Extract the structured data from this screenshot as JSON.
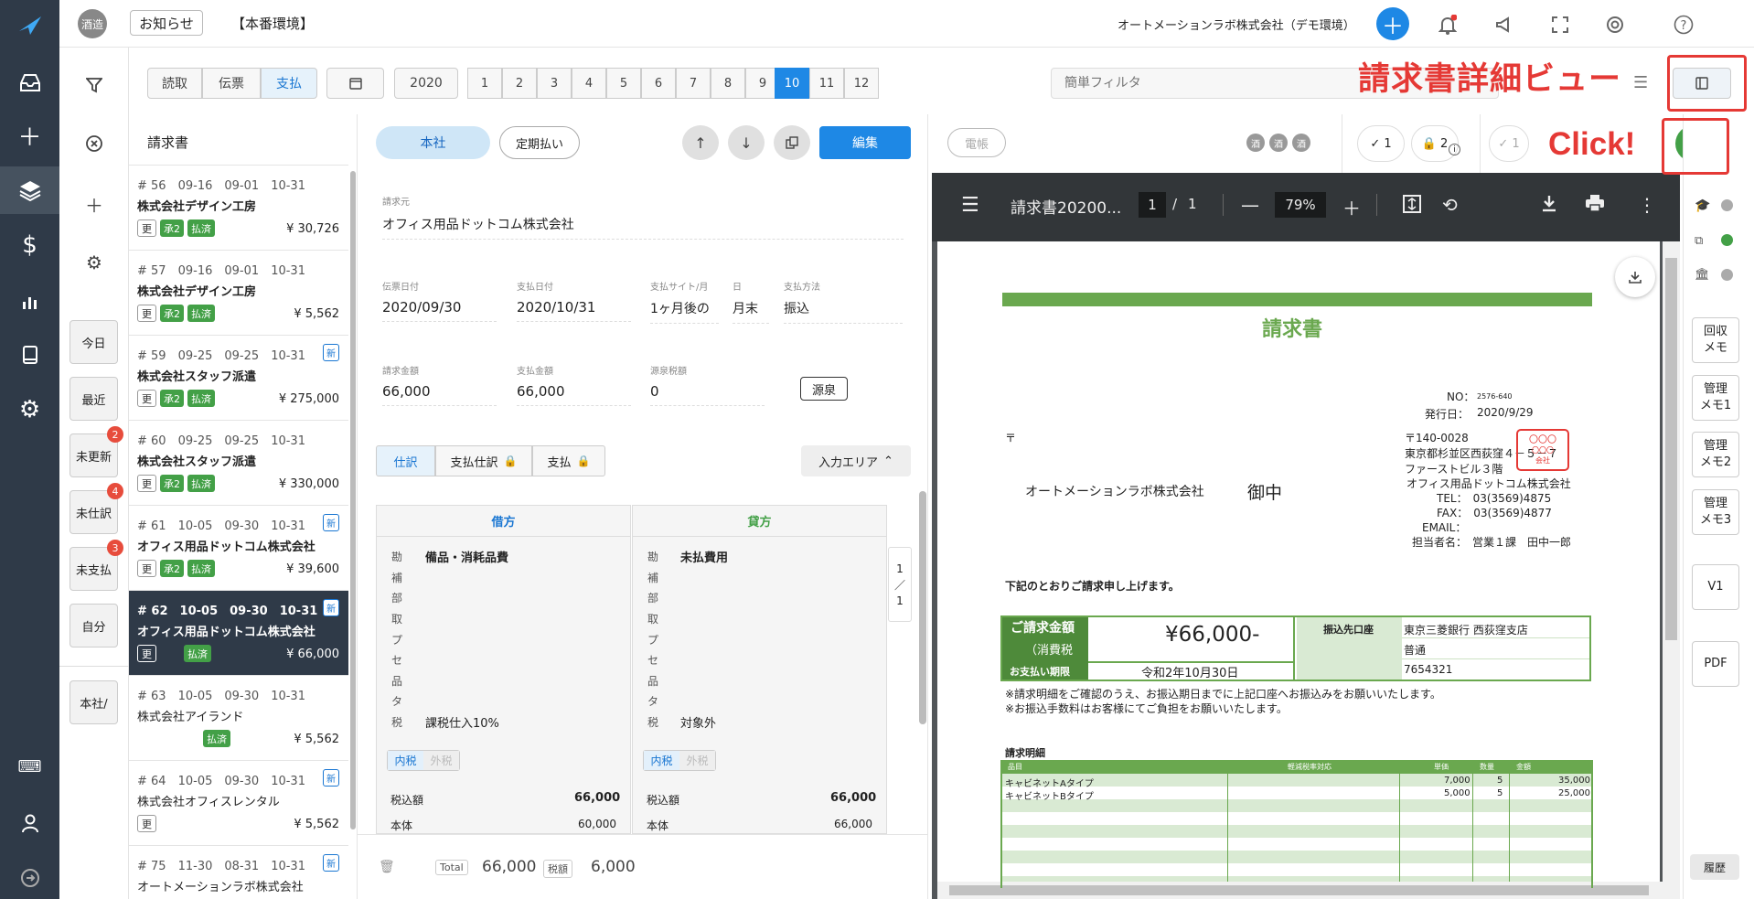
{
  "nav": {
    "icons": [
      "bird-logo-icon",
      "inbox-icon",
      "plus-icon",
      "layers-icon",
      "dollar-icon",
      "chart-icon",
      "book-icon",
      "gear-icon",
      "keyboard-icon",
      "user-icon",
      "logout-icon"
    ]
  },
  "topbar": {
    "user_badge": "酒造",
    "notice": "お知らせ",
    "env": "【本番環境】",
    "company": "オートメーションラボ株式会社（デモ環境）"
  },
  "filters": {
    "buttons": [
      {
        "label": "今日",
        "badge": ""
      },
      {
        "label": "最近",
        "badge": ""
      },
      {
        "label": "未更新",
        "badge": "2"
      },
      {
        "label": "未仕訳",
        "badge": "4"
      },
      {
        "label": "未支払",
        "badge": "3"
      },
      {
        "label": "自分",
        "badge": ""
      },
      {
        "label": "本社/",
        "badge": ""
      }
    ]
  },
  "toolbar": {
    "modes": [
      "読取",
      "伝票",
      "支払"
    ],
    "year": "2020",
    "months": [
      "1",
      "2",
      "3",
      "4",
      "5",
      "6",
      "7",
      "8",
      "9",
      "10",
      "11",
      "12"
    ],
    "selected_month": "10",
    "filter_placeholder": "簡単フィルタ"
  },
  "list": {
    "title": "請求書",
    "items": [
      {
        "no": "# 56",
        "d1": "09-16",
        "d2": "09-01",
        "d3": "10-31",
        "name": "株式会社デザイン工房",
        "tags": [
          "更",
          "承2",
          "払済"
        ],
        "amount": "¥ 30,726",
        "new": ""
      },
      {
        "no": "# 57",
        "d1": "09-16",
        "d2": "09-01",
        "d3": "10-31",
        "name": "株式会社デザイン工房",
        "tags": [
          "更",
          "承2",
          "払済"
        ],
        "amount": "¥ 5,562",
        "new": ""
      },
      {
        "no": "# 59",
        "d1": "09-25",
        "d2": "09-25",
        "d3": "10-31",
        "name": "株式会社スタッフ派遣",
        "tags": [
          "更",
          "承2",
          "払済"
        ],
        "amount": "¥ 275,000",
        "new": "新"
      },
      {
        "no": "# 60",
        "d1": "09-25",
        "d2": "09-25",
        "d3": "10-31",
        "name": "株式会社スタッフ派遣",
        "tags": [
          "更",
          "承2",
          "払済"
        ],
        "amount": "¥ 330,000",
        "new": ""
      },
      {
        "no": "# 61",
        "d1": "10-05",
        "d2": "09-30",
        "d3": "10-31",
        "name": "オフィス用品ドットコム株式会社",
        "tags": [
          "更",
          "承2",
          "払済"
        ],
        "amount": "¥ 39,600",
        "new": "新"
      },
      {
        "no": "# 62",
        "d1": "10-05",
        "d2": "09-30",
        "d3": "10-31",
        "name": "オフィス用品ドットコム株式会社",
        "tags": [
          "更",
          "",
          "払済"
        ],
        "amount": "¥ 66,000",
        "new": "新"
      },
      {
        "no": "# 63",
        "d1": "10-05",
        "d2": "09-30",
        "d3": "10-31",
        "name": "株式会社アイランド",
        "tags": [
          "",
          "",
          "払済"
        ],
        "amount": "¥ 5,562",
        "new": ""
      },
      {
        "no": "# 64",
        "d1": "10-05",
        "d2": "09-30",
        "d3": "10-31",
        "name": "株式会社オフィスレンタル",
        "tags": [
          "更",
          "",
          ""
        ],
        "amount": "¥ 5,562",
        "new": "新"
      },
      {
        "no": "# 75",
        "d1": "11-30",
        "d2": "08-31",
        "d3": "10-31",
        "name": "オートメーションラボ株式会社",
        "tags": [],
        "amount": "",
        "new": "新"
      }
    ]
  },
  "detail": {
    "tab_honsha": "本社",
    "tab_teiki": "定期払い",
    "edit": "編集",
    "vendor_label": "請求元",
    "vendor": "オフィス用品ドットコム株式会社",
    "f_denpyo_label": "伝票日付",
    "f_denpyo": "2020/09/30",
    "f_shiharai_label": "支払日付",
    "f_shiharai": "2020/10/31",
    "f_site_label": "支払サイト/月",
    "f_site": "1ヶ月後の",
    "f_day_label": "日",
    "f_day": "月末",
    "f_method_label": "支払方法",
    "f_method": "振込",
    "f_seikyu_label": "請求金額",
    "f_seikyu": "66,000",
    "f_shiharaikin_label": "支払金額",
    "f_shiharaikin": "66,000",
    "f_gensen_label": "源泉税額",
    "f_gensen": "0",
    "gensen_btn": "源泉",
    "subtabs": [
      "仕訳",
      "支払仕訳",
      "支払"
    ],
    "input_area": "入力エリア",
    "debit_head": "借方",
    "credit_head": "貸方",
    "row_labels": [
      "勘",
      "補",
      "部",
      "取",
      "プ",
      "セ",
      "品",
      "タ",
      "税"
    ],
    "debit_account": "備品・消耗品費",
    "debit_tax": "課税仕入10%",
    "credit_account": "未払費用",
    "credit_tax": "対象外",
    "tax_in": "内税",
    "tax_out": "外税",
    "zeikomi_label": "税込額",
    "hontai_label": "本体",
    "d_zeikomi": "66,000",
    "d_hontai": "60,000",
    "c_zeikomi": "66,000",
    "c_hontai": "66,000",
    "page": "1",
    "page_sep": "／",
    "page_total": "1",
    "total_label": "Total",
    "total": "66,000",
    "tax_label": "税額",
    "tax": "6,000"
  },
  "right": {
    "denchou": "電帳",
    "chips": [
      "酒",
      "酒",
      "酒"
    ],
    "check1": "1",
    "lock1": "2",
    "check2": "1",
    "avatar": "酒造"
  },
  "pdf": {
    "filename": "請求書20200...",
    "page": "1",
    "page_sep": "/",
    "pages": "1",
    "zoom": "79%"
  },
  "invoice": {
    "title": "請求書",
    "no_label": "NO：",
    "no": "2576-640",
    "date_label": "発行日：",
    "date": "2020/9/29",
    "postal_mark": "〒",
    "zip": "〒140-0028",
    "addr1": "東京都杉並区西荻窪４－５－７",
    "addr2": "ファーストビル３階",
    "from_company": "オフィス用品ドットコム株式会社",
    "tel": "TEL：　03(3569)4875",
    "fax": "FAX：　03(3569)4877",
    "email": "EMAIL：",
    "person": "担当者名：　営業１課　田中一郎",
    "to_company": "オートメーションラボ株式会社",
    "onchu": "御中",
    "stamp1": "〇〇〇",
    "stamp2": "〇〇〇",
    "stamp3": "会社",
    "intro": "下記のとおりご請求申し上げます。",
    "amount_label": "ご請求金額",
    "tax_note": "（消費税",
    "amount": "¥66,000-",
    "due_label": "お支払い期限",
    "due": "令和2年10月30日",
    "bank_label": "振込先口座",
    "bank": "東京三菱銀行 西荻窪支店",
    "acct_type": "普通",
    "acct_no": "7654321",
    "note1": "※請求明細をご確認のうえ、お振込期日までに上記口座へお振込みをお願いいたします。",
    "note2": "※お振込手数料はお客様にてご負担をお願いいたします。",
    "detail_label": "請求明細",
    "cols": [
      "品目",
      "軽減税率対応",
      "単価",
      "数量",
      "金額"
    ],
    "rows": [
      {
        "item": "キャビネットAタイプ",
        "price": "7,000",
        "qty": "5",
        "amount": "35,000"
      },
      {
        "item": "キャビネットBタイプ",
        "price": "5,000",
        "qty": "5",
        "amount": "25,000"
      }
    ]
  },
  "rside": {
    "buttons": [
      "回収\nメモ",
      "管理\nメモ1",
      "管理\nメモ2",
      "管理\nメモ3",
      "V1",
      "PDF"
    ],
    "history": "履歴"
  },
  "annotation": {
    "title": "請求書詳細ビュー",
    "click": "Click!"
  },
  "colors": {
    "accent": "#1e88e5",
    "green": "#43a047",
    "invoice_green": "#6aa84f",
    "annotation": "#e53935",
    "nav": "#2f3a48"
  }
}
